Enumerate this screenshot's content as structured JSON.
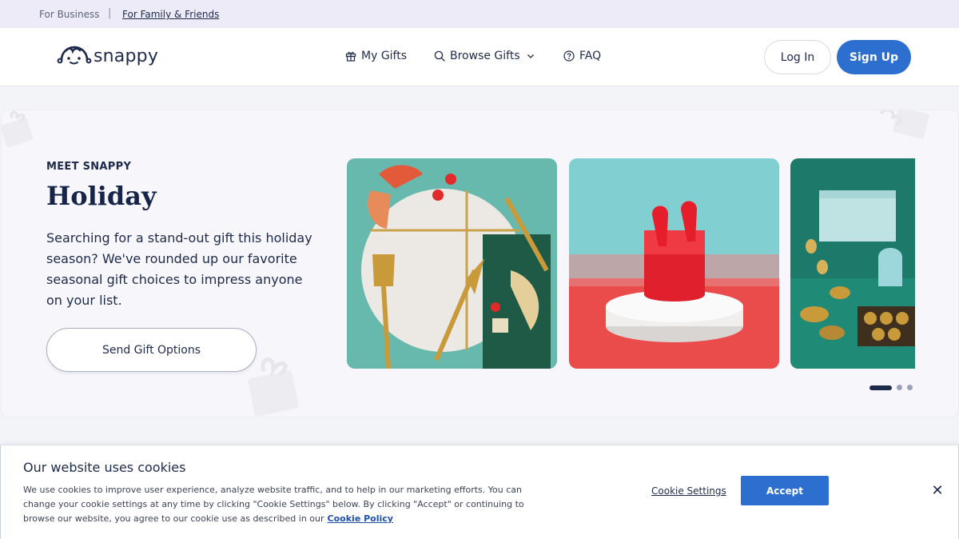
{
  "topbar": {
    "business_link": "For Business",
    "separator": "|",
    "family_link": "For Family & Friends"
  },
  "header": {
    "logo_text": "snappy",
    "nav": [
      {
        "label": "My Gifts",
        "icon": "gift-icon"
      },
      {
        "label": "Browse Gifts",
        "icon": "search-icon"
      },
      {
        "label": "FAQ",
        "icon": "help-circle-icon"
      }
    ],
    "login_label": "Log In",
    "signup_label": "Sign Up"
  },
  "hero": {
    "eyebrow": "MEET SNAPPY",
    "title": "Holiday",
    "description": "Searching for a stand-out gift this holiday season? We've rounded up our favorite seasonal gift choices to impress anyone on your list.",
    "button_label": "Send Gift Options",
    "carousel": {
      "slides": [
        "cheese-board-image",
        "red-earbuds-image",
        "tea-set-image"
      ],
      "active_index": 0,
      "dot_count": 3
    }
  },
  "cookie_banner": {
    "title": "Our website uses cookies",
    "text": "We use cookies to improve user experience, analyze website traffic, and to help in our marketing efforts. You can change your cookie settings at any time by clicking \"Cookie Settings\" below. By clicking \"Accept\" or continuing to browse our website, you agree to our cookie use as described in our",
    "policy_link": "Cookie Policy",
    "settings_label": "Cookie Settings",
    "accept_label": "Accept",
    "close_label": "✕"
  },
  "colors": {
    "brand_blue": "#2c6fce",
    "navy_text": "#1e2a4a",
    "top_strip_bg": "#ecebf7"
  }
}
